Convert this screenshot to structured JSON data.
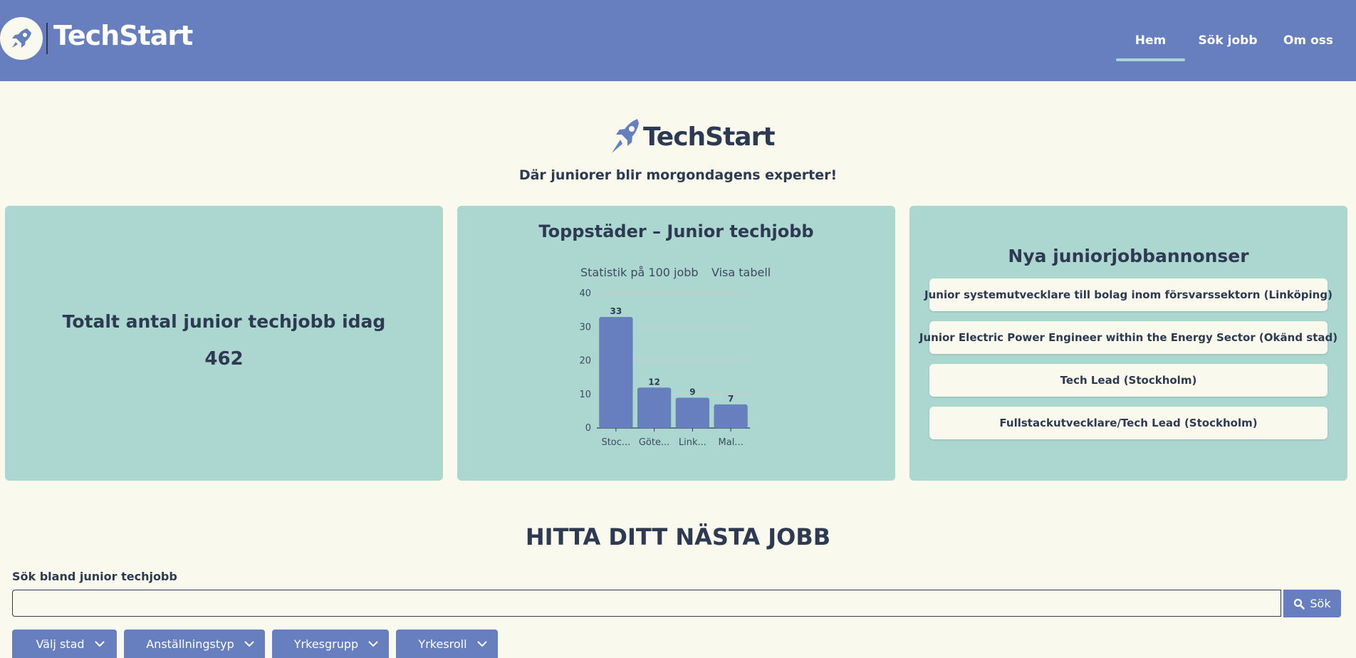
{
  "header": {
    "brand": "TechStart",
    "nav": [
      {
        "label": "Hem",
        "active": true
      },
      {
        "label": "Sök jobb",
        "active": false
      },
      {
        "label": "Om oss",
        "active": false
      }
    ]
  },
  "hero": {
    "brand": "TechStart",
    "tagline": "Där juniorer blir morgondagens experter!"
  },
  "stats": {
    "title": "Totalt antal junior techjobb idag",
    "value": "462"
  },
  "chart_card": {
    "title": "Toppstäder – Junior techjobb",
    "subtitle": "Statistik på 100 jobb",
    "toggle_label": "Visa tabell"
  },
  "chart_data": {
    "type": "bar",
    "categories": [
      "Stoc...",
      "Göte...",
      "Link...",
      "Mal..."
    ],
    "values": [
      33,
      12,
      9,
      7
    ],
    "ylim": [
      0,
      40
    ],
    "yticks": [
      0,
      10,
      20,
      30,
      40
    ],
    "grid": true,
    "bar_color": "#677fbf"
  },
  "jobs": {
    "title": "Nya juniorjobbannonser",
    "items": [
      "Junior systemutvecklare till bolag inom försvarssektorn (Linköping)",
      "Junior Electric Power Engineer within the Energy Sector (Okänd stad)",
      "Tech Lead (Stockholm)",
      "Fullstackutvecklare/Tech Lead (Stockholm)"
    ]
  },
  "search": {
    "section_title": "HITTA DITT NÄSTA JOBB",
    "label": "Sök bland junior techjobb",
    "placeholder": "",
    "button_label": "Sök",
    "filters": [
      "Välj stad",
      "Anställningstyp",
      "Yrkesgrupp",
      "Yrkesroll"
    ]
  },
  "colors": {
    "header_bg": "#677fbf",
    "page_bg": "#faf9ee",
    "card_bg": "#acd6d0",
    "text": "#2e3a52",
    "accent": "#677fbf",
    "nav_underline": "#a9d6d0"
  }
}
